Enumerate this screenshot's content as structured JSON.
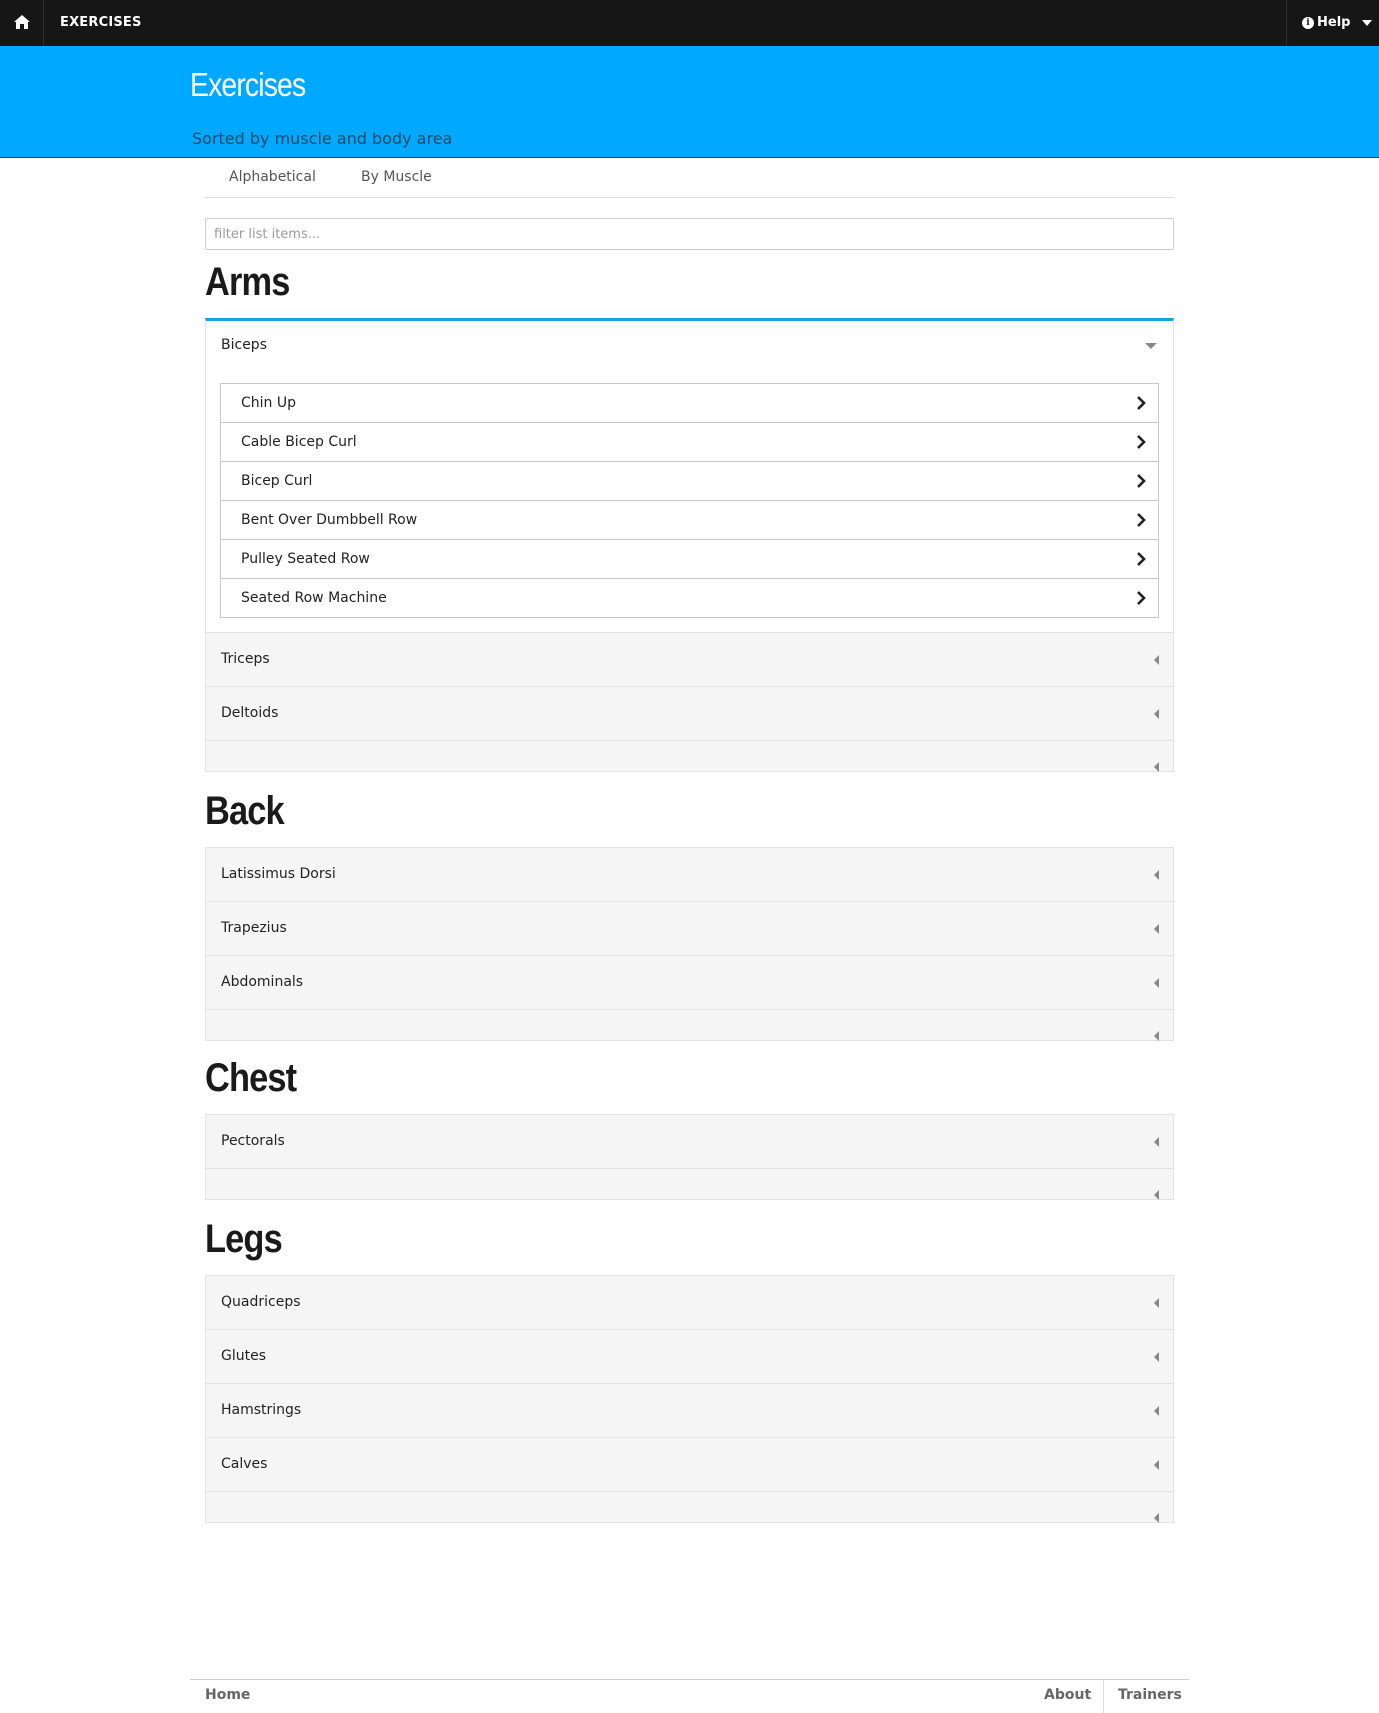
{
  "navbar": {
    "home_icon": "home-icon",
    "brand": "EXERCISES",
    "help_icon": "info-icon",
    "help_label": "Help"
  },
  "header": {
    "title": "Exercises",
    "subtitle": "Sorted by muscle and body area"
  },
  "tabs": [
    {
      "label": "Alphabetical"
    },
    {
      "label": "By Muscle"
    }
  ],
  "filter": {
    "placeholder": "filter list items...",
    "value": ""
  },
  "sections": [
    {
      "title": "Arms",
      "groups": [
        {
          "label": "Biceps",
          "expanded": true,
          "exercises": [
            "Chin Up",
            "Cable Bicep Curl",
            "Bicep Curl",
            "Bent Over Dumbbell Row",
            "Pulley Seated Row",
            "Seated Row Machine"
          ]
        },
        {
          "label": "Triceps",
          "expanded": false
        },
        {
          "label": "Deltoids",
          "expanded": false
        }
      ]
    },
    {
      "title": "Back",
      "groups": [
        {
          "label": "Latissimus Dorsi",
          "expanded": false
        },
        {
          "label": "Trapezius",
          "expanded": false
        },
        {
          "label": "Abdominals",
          "expanded": false
        }
      ]
    },
    {
      "title": "Chest",
      "groups": [
        {
          "label": "Pectorals",
          "expanded": false
        }
      ]
    },
    {
      "title": "Legs",
      "groups": [
        {
          "label": "Quadriceps",
          "expanded": false
        },
        {
          "label": "Glutes",
          "expanded": false
        },
        {
          "label": "Hamstrings",
          "expanded": false
        },
        {
          "label": "Calves",
          "expanded": false
        }
      ]
    }
  ],
  "footer": {
    "home": "Home",
    "about": "About",
    "trainers": "Trainers"
  },
  "colors": {
    "navbar": "#161616",
    "banner": "#00a8ff",
    "active_border": "#1a9fe0"
  }
}
